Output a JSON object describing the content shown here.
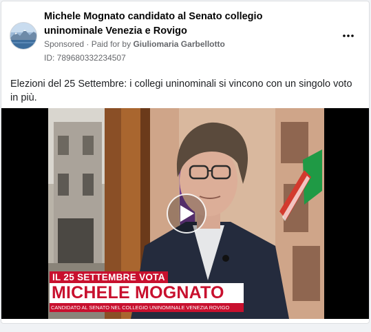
{
  "ad": {
    "page_name": "Michele Mognato candidato al Senato collegio uninominale Venezia e Rovigo",
    "sponsored": "Sponsored",
    "paid_for_prefix": "Paid for by",
    "paid_by": "Giuliomaria Garbellotto",
    "id_line": "ID: 789680332234507",
    "body_text": "Elezioni del 25 Settembre: i collegi uninominali si vincono con un singolo voto in più."
  },
  "video": {
    "caption_date": "IL 25 SETTEMBRE VOTA",
    "caption_name": "MICHELE MOGNATO",
    "caption_sub": "CANDIDATO AL SENATO NEL COLLEGIO UNINOMINALE VENEZIA ROVIGO",
    "play_icon": "play-icon"
  },
  "icons": {
    "more": "more-options-icon",
    "avatar": "page-avatar"
  },
  "colors": {
    "accent_red": "#c8102e",
    "text_secondary": "#65676b"
  }
}
